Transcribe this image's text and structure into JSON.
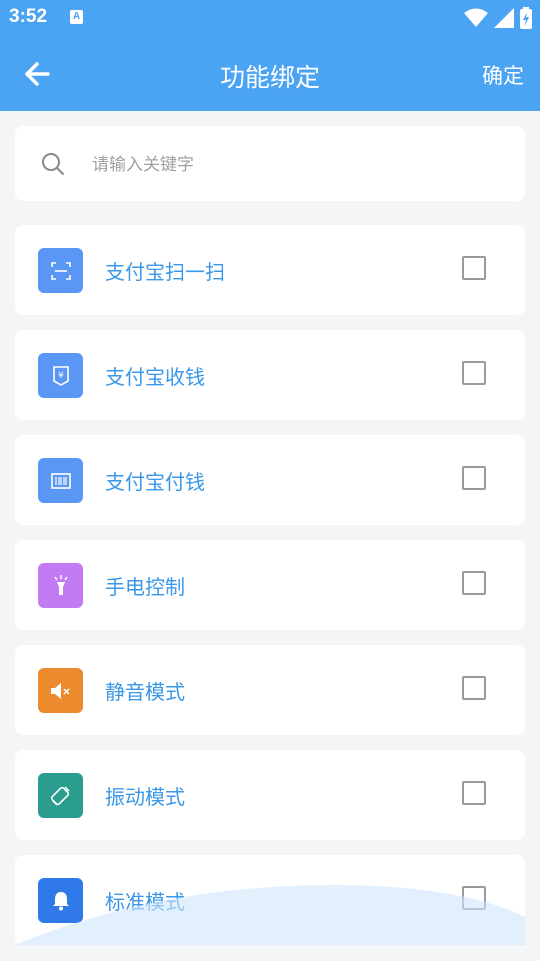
{
  "status_bar": {
    "time": "3:52",
    "notification_icon_letter": "A"
  },
  "app_bar": {
    "title": "功能绑定",
    "confirm_label": "确定"
  },
  "search": {
    "placeholder": "请输入关键字",
    "value": ""
  },
  "items": [
    {
      "label": "支付宝扫一扫",
      "icon": "scan-icon",
      "icon_color": "#5a97f5",
      "checked": false
    },
    {
      "label": "支付宝收钱",
      "icon": "receive-money-icon",
      "icon_color": "#5a97f5",
      "checked": false
    },
    {
      "label": "支付宝付钱",
      "icon": "barcode-icon",
      "icon_color": "#5a97f5",
      "checked": false
    },
    {
      "label": "手电控制",
      "icon": "flashlight-icon",
      "icon_color": "#c27bf2",
      "checked": false
    },
    {
      "label": "静音模式",
      "icon": "mute-icon",
      "icon_color": "#ec8a2e",
      "checked": false
    },
    {
      "label": "振动模式",
      "icon": "vibrate-icon",
      "icon_color": "#2a9d8f",
      "checked": false
    },
    {
      "label": "标准模式",
      "icon": "bell-icon",
      "icon_color": "#2f79e8",
      "checked": false
    }
  ],
  "colors": {
    "primary": "#4aa3f3",
    "label": "#3b97e8",
    "background": "#f4f5f7"
  }
}
